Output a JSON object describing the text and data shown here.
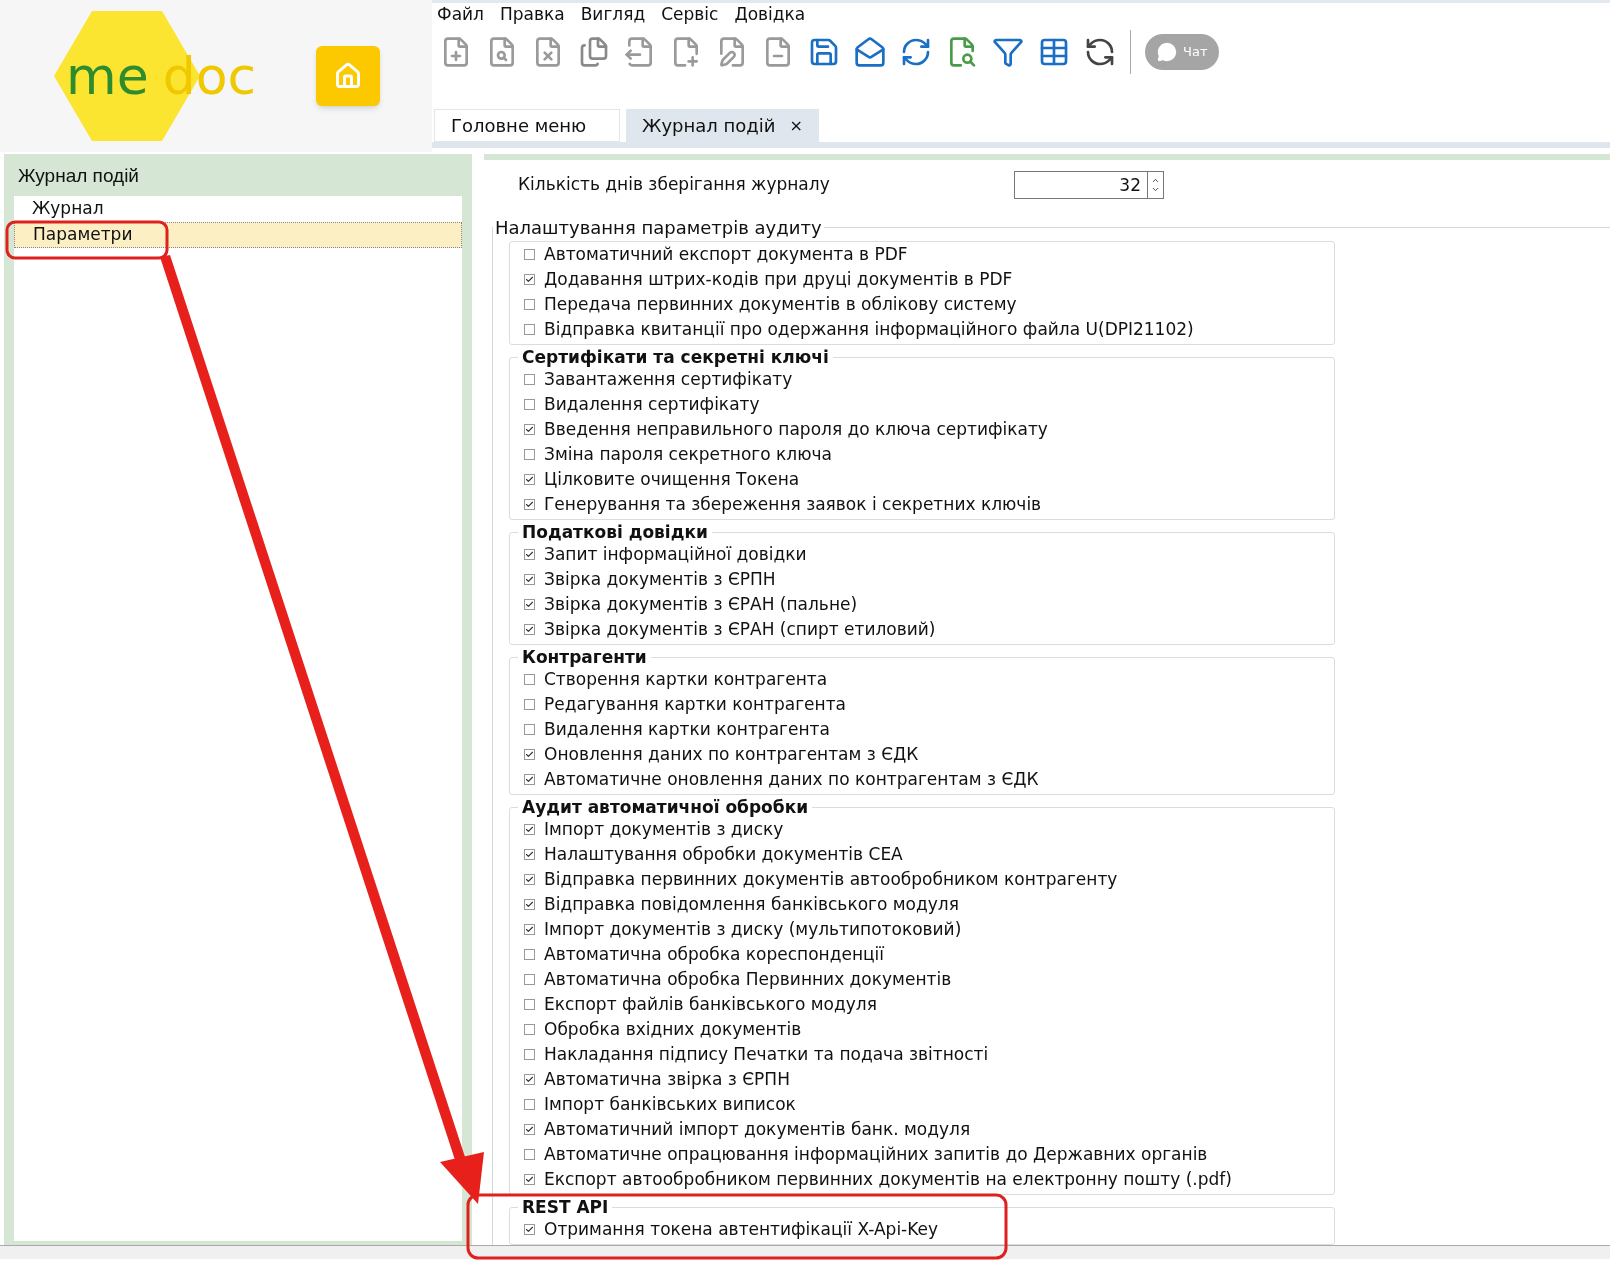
{
  "logo": {
    "part_1": "me",
    "part_2": "doc"
  },
  "menu": [
    "Файл",
    "Правка",
    "Вигляд",
    "Сервіс",
    "Довідка"
  ],
  "chat_button": "Чат",
  "tabs": [
    {
      "label": "Головне меню",
      "selected": false
    },
    {
      "label": "Журнал подій",
      "selected": true,
      "close": "×"
    }
  ],
  "sidebar": {
    "title": "Журнал подій",
    "items": [
      {
        "label": "Журнал",
        "selected": false
      },
      {
        "label": "Параметри",
        "selected": true
      }
    ]
  },
  "retention": {
    "label": "Кількість днів зберігання журналу",
    "value": "32"
  },
  "audit": {
    "title": "Налаштування параметрів аудиту",
    "groups": [
      {
        "items": [
          {
            "label": "Автоматичний експорт документа в PDF",
            "checked": false
          },
          {
            "label": "Додавання штрих-кодів при друці документів в PDF",
            "checked": true
          },
          {
            "label": "Передача первинних документів в облікову систему",
            "checked": false
          },
          {
            "label": "Відправка квитанції про одержання інформаційного файла U(DPI21102)",
            "checked": false
          }
        ]
      },
      {
        "title": "Сертифікати та секретні ключі",
        "items": [
          {
            "label": "Завантаження сертифікату",
            "checked": false
          },
          {
            "label": "Видалення сертифікату",
            "checked": false
          },
          {
            "label": "Введення неправильного пароля до ключа сертифікату",
            "checked": true
          },
          {
            "label": "Зміна пароля секретного ключа",
            "checked": false
          },
          {
            "label": "Цілковите очищення Токена",
            "checked": true
          },
          {
            "label": "Генерування та збереження заявок і секретних ключів",
            "checked": true
          }
        ]
      },
      {
        "title": "Податкові довідки",
        "items": [
          {
            "label": "Запит інформаційної довідки",
            "checked": true
          },
          {
            "label": "Звірка документів з ЄРПН",
            "checked": true
          },
          {
            "label": "Звірка документів з ЄРАН (пальне)",
            "checked": true
          },
          {
            "label": "Звірка документів з ЄРАН (спирт етиловий)",
            "checked": true
          }
        ]
      },
      {
        "title": "Контрагенти",
        "items": [
          {
            "label": "Створення картки контрагента",
            "checked": false
          },
          {
            "label": "Редагування картки контрагента",
            "checked": false
          },
          {
            "label": "Видалення картки контрагента",
            "checked": false
          },
          {
            "label": "Оновлення даних по контрагентам з ЄДК",
            "checked": true
          },
          {
            "label": "Автоматичне оновлення даних по контрагентам з ЄДК",
            "checked": true
          }
        ]
      },
      {
        "title": "Аудит автоматичної обробки",
        "items": [
          {
            "label": "Імпорт документів з диску",
            "checked": true
          },
          {
            "label": "Налаштування обробки документів СЕА",
            "checked": true
          },
          {
            "label": "Відправка первинних документів автообробником контрагенту",
            "checked": true
          },
          {
            "label": "Відправка повідомлення банківського модуля",
            "checked": true
          },
          {
            "label": "Імпорт документів з диску (мультипотоковий)",
            "checked": true
          },
          {
            "label": "Автоматична обробка кореспонденції",
            "checked": false
          },
          {
            "label": "Автоматична обробка Первинних документів",
            "checked": false
          },
          {
            "label": "Експорт файлів банківського модуля",
            "checked": false
          },
          {
            "label": "Обробка вхідних документів",
            "checked": false
          },
          {
            "label": "Накладання підпису Печатки та подача звітності",
            "checked": false
          },
          {
            "label": "Автоматична звірка з ЄРПН",
            "checked": true
          },
          {
            "label": "Імпорт банківських виписок",
            "checked": false
          },
          {
            "label": "Автоматичний імпорт документів банк. модуля",
            "checked": true
          },
          {
            "label": "Автоматичне опрацювання інформаційних запитів до Державних органів",
            "checked": false
          },
          {
            "label": "Експорт автообробником первинних документів на електронну пошту (.pdf)",
            "checked": true
          }
        ]
      },
      {
        "title": "REST API",
        "items": [
          {
            "label": "Отримання токена автентифікації X-Api-Key",
            "checked": true
          }
        ]
      }
    ]
  }
}
